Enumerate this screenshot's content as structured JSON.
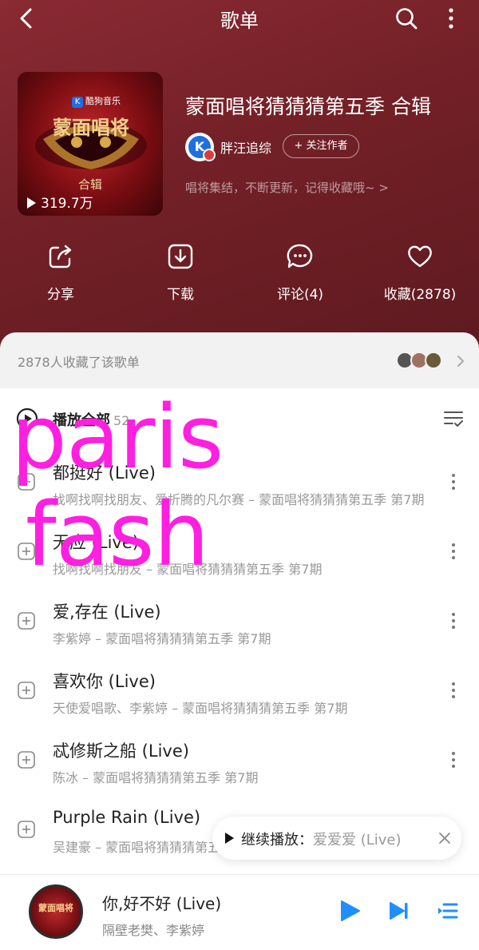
{
  "topbar": {
    "title": "歌单"
  },
  "cover": {
    "brand": "酷狗音乐",
    "sub_label": "合辑",
    "play_count": "319.7万"
  },
  "playlist": {
    "title": "蒙面唱将猜猜猜第五季 合辑",
    "creator": "胖汪追综",
    "follow_label": "+ 关注作者",
    "description": "唱将集结，不断更新，记得收藏哦~ >"
  },
  "actions": [
    {
      "icon": "share-icon",
      "label": "分享"
    },
    {
      "icon": "download-icon",
      "label": "下载"
    },
    {
      "icon": "comment-icon",
      "label": "评论(4)"
    },
    {
      "icon": "heart-icon",
      "label": "收藏(2878)"
    }
  ],
  "collect": {
    "text": "2878人收藏了该歌单"
  },
  "play_all": {
    "label": "播放全部",
    "count": "52"
  },
  "songs": [
    {
      "title": "都挺好 (Live)",
      "subtitle": "找啊找啊找朋友、爱折腾的凡尔赛 – 蒙面唱将猜猜猜第五季 第7期"
    },
    {
      "title": "无应 (Live)",
      "subtitle": "找啊找啊找朋友 – 蒙面唱将猜猜猜第五季 第7期"
    },
    {
      "title": "爱,存在 (Live)",
      "subtitle": "李紫婷 – 蒙面唱将猜猜猜第五季 第7期"
    },
    {
      "title": "喜欢你 (Live)",
      "subtitle": "天使爱唱歌、李紫婷 – 蒙面唱将猜猜猜第五季 第7期"
    },
    {
      "title": "忒修斯之船 (Live)",
      "subtitle": "陈冰 – 蒙面唱将猜猜猜第五季 第7期"
    },
    {
      "title": "Purple Rain (Live)",
      "subtitle": "吴建豪 – 蒙面唱将猜猜猜第五季 第7期"
    }
  ],
  "continue_popup": {
    "label": "继续播放：",
    "song": "爱爱爱 (Live)"
  },
  "player": {
    "title": "你,好不好 (Live)",
    "artist": "隔壁老樊、李紫婷",
    "disc_label": "蒙面唱将"
  },
  "watermark": {
    "line1": "paris",
    "line2": "fash"
  },
  "colors": {
    "header_bg": "#7a232b",
    "accent": "#1f8fff",
    "watermark": "#ff1fe0"
  }
}
